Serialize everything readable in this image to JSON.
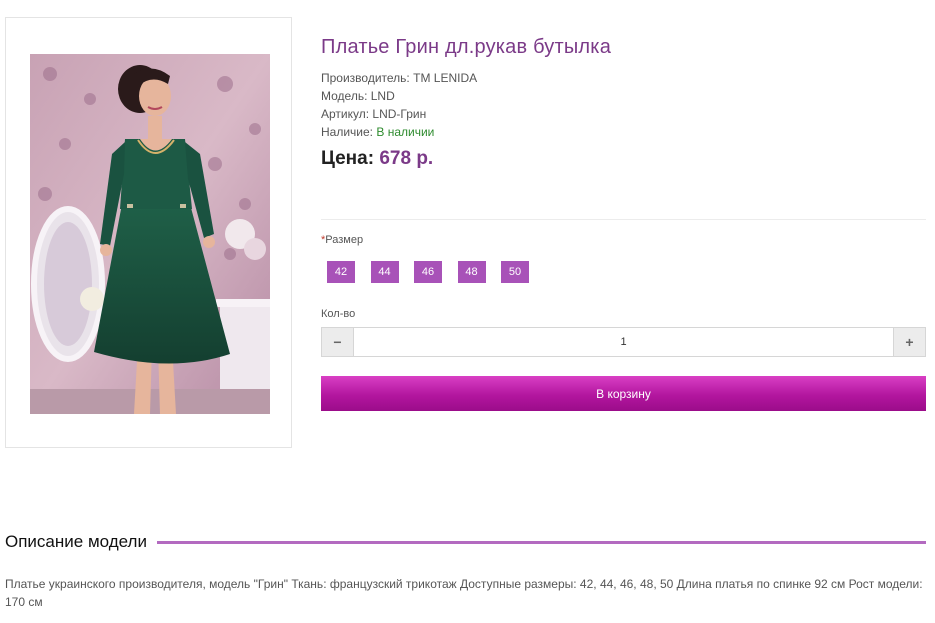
{
  "product": {
    "title": "Платье Грин дл.рукав бутылка",
    "manufacturer_label": "Производитель:",
    "manufacturer": "TM LENIDA",
    "model_label": "Модель:",
    "model": "LND",
    "sku_label": "Артикул:",
    "sku": "LND-Грин",
    "availability_label": "Наличие:",
    "availability": "В наличии",
    "price_label": "Цена:",
    "price": "678 р."
  },
  "options": {
    "size_required_mark": "*",
    "size_label": "Размер",
    "sizes": [
      "42",
      "44",
      "46",
      "48",
      "50"
    ]
  },
  "quantity": {
    "label": "Кол-во",
    "value": "1",
    "decrease_icon": "minus-icon",
    "increase_icon": "plus-icon"
  },
  "cart": {
    "button_label": "В корзину"
  },
  "description": {
    "heading": "Описание модели",
    "text": "Платье украинского производителя, модель \"Грин\" Ткань: французский трикотаж Доступные размеры: 42, 44, 46, 48, 50 Длина платья по спинке 92 см Рост модели: 170 см"
  },
  "colors": {
    "accent": "#7b3a88",
    "size_button": "#a852b8",
    "cart_button": "#b3169f",
    "in_stock": "#2e8b2e",
    "dress": "#1d5a45"
  }
}
